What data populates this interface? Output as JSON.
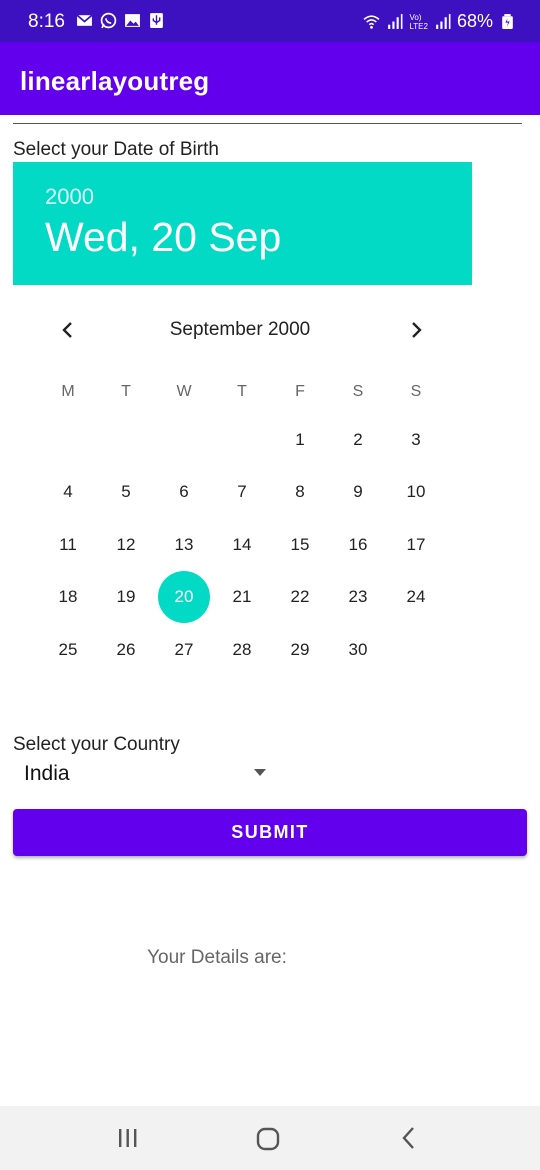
{
  "status_bar": {
    "time": "8:16",
    "battery": "68%",
    "network_label_top": "Vo)",
    "network_label_bottom": "LTE2"
  },
  "app_bar": {
    "title": "linearlayoutreg"
  },
  "form": {
    "dob_label": "Select your Date of Birth",
    "country_label": "Select your Country",
    "country_value": "India",
    "submit_label": "SUBMIT",
    "details_label": "Your Details are:"
  },
  "date_picker": {
    "year": "2000",
    "header_date": "Wed, 20 Sep",
    "month_label": "September 2000",
    "weekdays": [
      "M",
      "T",
      "W",
      "T",
      "F",
      "S",
      "S"
    ],
    "weeks": [
      [
        "",
        "",
        "",
        "",
        "1",
        "2",
        "3"
      ],
      [
        "4",
        "5",
        "6",
        "7",
        "8",
        "9",
        "10"
      ],
      [
        "11",
        "12",
        "13",
        "14",
        "15",
        "16",
        "17"
      ],
      [
        "18",
        "19",
        "20",
        "21",
        "22",
        "23",
        "24"
      ],
      [
        "25",
        "26",
        "27",
        "28",
        "29",
        "30",
        ""
      ]
    ],
    "selected_day": "20",
    "accent_color": "#03dac5"
  },
  "colors": {
    "primary": "#6200ee",
    "primary_dark": "#3d10c0",
    "accent": "#03dac5"
  }
}
